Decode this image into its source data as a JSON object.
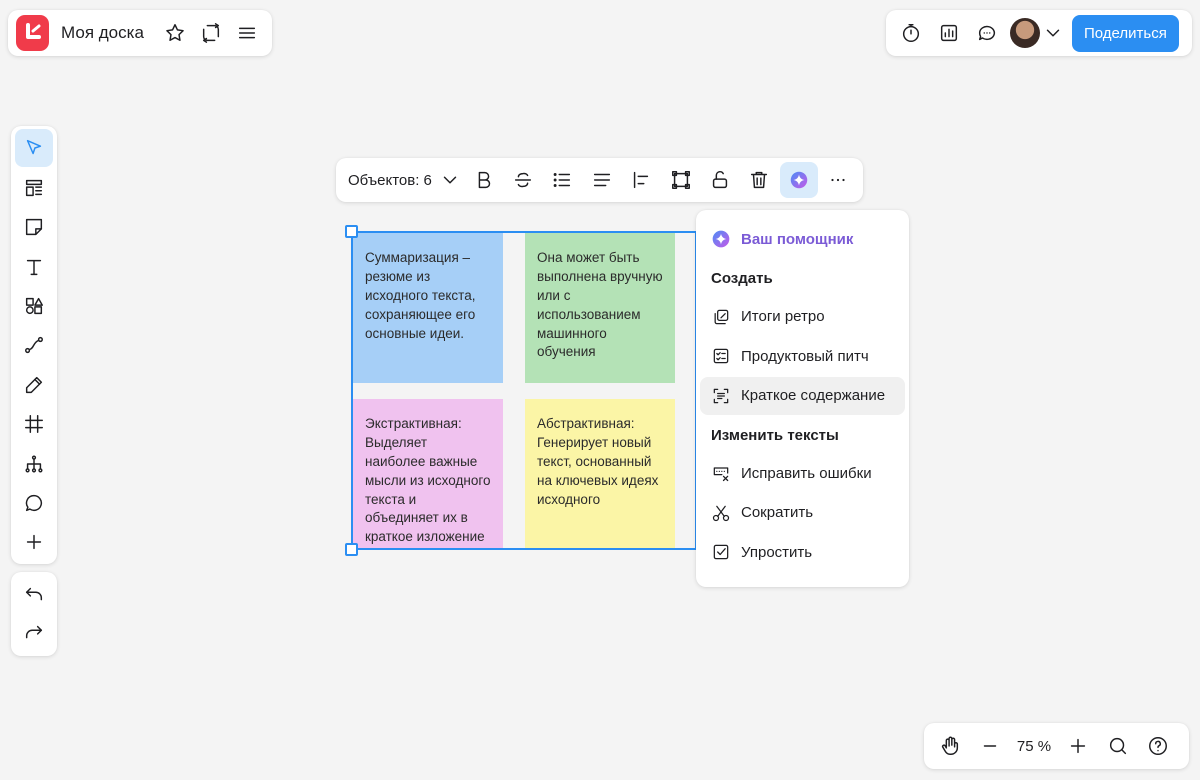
{
  "header": {
    "board_title": "Моя доска",
    "share_label": "Поделиться"
  },
  "context_toolbar": {
    "objects_label": "Объектов: 6"
  },
  "stickies": [
    {
      "text": "Суммаризация – резюме из исходного текста, сохраняющее его основные идеи.",
      "color": "#a6cff7"
    },
    {
      "text": "Она может быть выполнена вручную или с использованием машинного обучения",
      "color": "#b4e2b6"
    },
    {
      "text": "Экстрактивная: Выделяет наиболее важные мысли из исходного текста и объединяет их в краткое изложение",
      "color": "#f0c2ef"
    },
    {
      "text": "Абстрактивная: Генерирует новый текст, основанный на ключевых идеях исходного",
      "color": "#fbf5a6"
    }
  ],
  "assistant_menu": {
    "title": "Ваш помощник",
    "section_create": "Создать",
    "create_items": [
      "Итоги ретро",
      "Продуктовый питч",
      "Краткое содержание"
    ],
    "section_edit": "Изменить тексты",
    "edit_items": [
      "Исправить ошибки",
      "Сократить",
      "Упростить"
    ]
  },
  "zoom": {
    "value": "75 %"
  },
  "colors": {
    "accent": "#2b8ef2",
    "logo": "#f03b4a",
    "assistant": "#7b5bd6"
  },
  "icons": {
    "left_toolbar": [
      "cursor-icon",
      "templates-icon",
      "sticky-note-icon",
      "text-icon",
      "shapes-icon",
      "connector-icon",
      "pen-icon",
      "frame-icon",
      "mindmap-icon",
      "comment-icon",
      "plus-icon"
    ],
    "context_toolbar": [
      "bold-icon",
      "strikethrough-icon",
      "bullet-list-icon",
      "align-icon",
      "align-left-icon",
      "frame-icon",
      "unlock-icon",
      "trash-icon",
      "ai-sparkle-icon",
      "more-icon"
    ]
  }
}
